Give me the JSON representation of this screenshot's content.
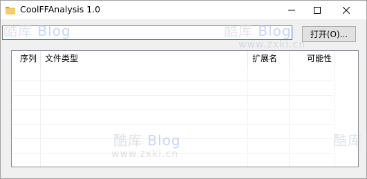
{
  "window": {
    "title": "CoolFFAnalysis 1.0",
    "icons": {
      "app": "folder-icon",
      "minimize": "minimize-icon",
      "maximize": "maximize-icon",
      "close": "close-icon"
    }
  },
  "toolbar": {
    "path_value": "",
    "open_label": "打开(O)..."
  },
  "table": {
    "columns": [
      "序列",
      "文件类型",
      "扩展名",
      "可能性"
    ],
    "rows": []
  },
  "watermark": {
    "brand": "酷库",
    "brand_accent": "Blog",
    "url": "www.zxki.cn"
  }
}
